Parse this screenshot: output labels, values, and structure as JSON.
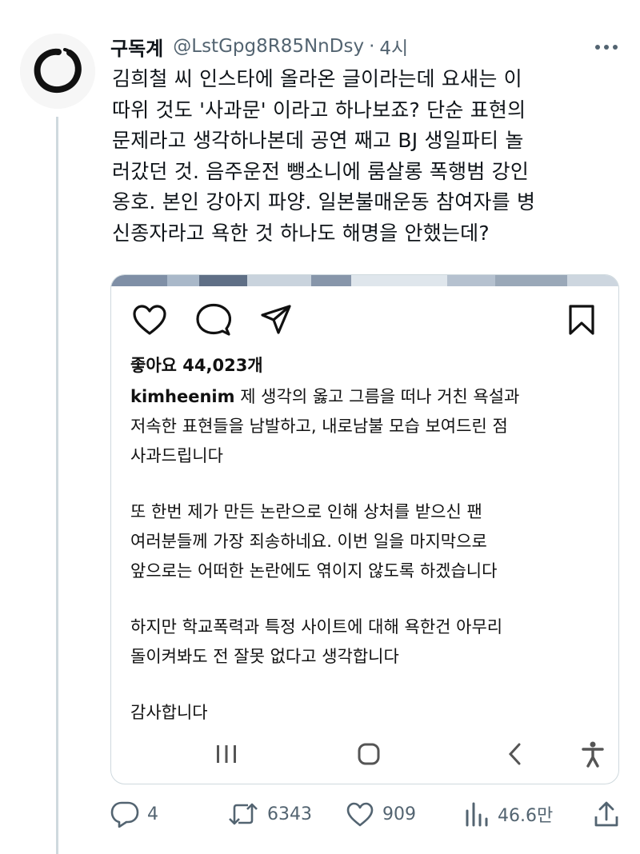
{
  "tweet": {
    "display_name": "구독계",
    "handle": "@LstGpg8R85NnDsy",
    "separator": "·",
    "time": "4시",
    "text_lines": [
      "김희철 씨 인스타에 올라온 글이라는데 요새는 이",
      "따위 것도 '사과문' 이라고 하나보죠? 단순 표현의",
      "문제라고 생각하나본데 공연 째고 BJ 생일파티 놀",
      "러갔던 것. 음주운전 뺑소니에 룸살롱 폭행범 강인",
      "옹호. 본인 강아지 파양. 일본불매운동 참여자를 병",
      "신종자라고 욕한 것 하나도 해명을 안했는데?"
    ]
  },
  "instagram": {
    "likes": "좋아요 44,023개",
    "username": "kimheenim",
    "caption_first_line": " 제 생각의 옳고 그름을 떠나 거친 욕설과",
    "caption_lines": [
      "저속한 표현들을 남발하고, 내로남불 모습 보여드린 점",
      "사과드립니다",
      "",
      "또 한번 제가 만든 논란으로 인해 상처를 받으신 팬",
      "여러분들께 가장 죄송하네요. 이번 일을 마지막으로",
      "앞으로는 어떠한 논란에도 엮이지 않도록 하겠습니다",
      "",
      "하지만 학교폭력과 특정 사이트에 대해 욕한건 아무리",
      "돌이켜봐도 전 잘못 없다고 생각합니다",
      "",
      "감사합니다"
    ]
  },
  "actions": {
    "replies": "4",
    "retweets": "6343",
    "likes": "909",
    "views": "46.6만"
  },
  "icons": {
    "more": "more-dots-icon",
    "heart": "heart-icon",
    "comment": "comment-bubble-icon",
    "share": "send-paper-plane-icon",
    "bookmark": "bookmark-icon",
    "recents": "recents-icon",
    "home": "home-icon",
    "back": "back-chevron-icon",
    "accessibility": "accessibility-icon",
    "reply": "reply-icon",
    "retweet": "retweet-icon",
    "like": "like-icon",
    "views": "views-chart-icon",
    "upload": "upload-icon"
  },
  "colors": {
    "text": "#0f1419",
    "secondary": "#536471",
    "border": "#cfd9de"
  }
}
